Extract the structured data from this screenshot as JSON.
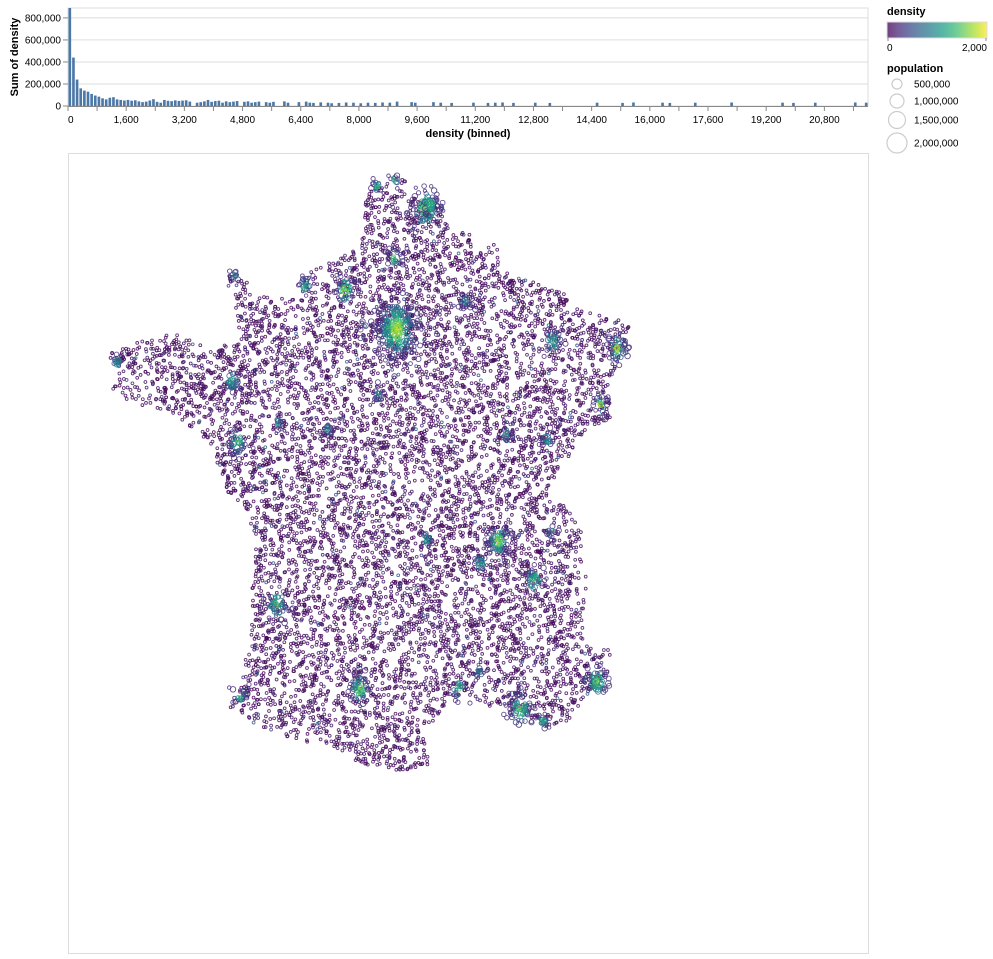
{
  "chart_data": [
    {
      "type": "bar",
      "xlabel": "density (binned)",
      "ylabel": "Sum of density",
      "x_ticks": [
        "0",
        "1,600",
        "3,200",
        "4,800",
        "6,400",
        "8,000",
        "9,600",
        "11,200",
        "12,800",
        "14,400",
        "16,000",
        "17,600",
        "19,200",
        "20,800"
      ],
      "y_ticks": [
        "0",
        "200,000",
        "400,000",
        "600,000",
        "800,000"
      ],
      "xlim": [
        0,
        22000
      ],
      "ylim": [
        0,
        890000
      ],
      "bin_width": 100,
      "bar_color": "#4c78a8",
      "grid": true,
      "bins": [
        {
          "x": 0,
          "y": 890000
        },
        {
          "x": 100,
          "y": 440000
        },
        {
          "x": 200,
          "y": 240000
        },
        {
          "x": 300,
          "y": 160000
        },
        {
          "x": 400,
          "y": 140000
        },
        {
          "x": 500,
          "y": 130000
        },
        {
          "x": 600,
          "y": 110000
        },
        {
          "x": 700,
          "y": 95000
        },
        {
          "x": 800,
          "y": 85000
        },
        {
          "x": 900,
          "y": 70000
        },
        {
          "x": 1000,
          "y": 60000
        },
        {
          "x": 1100,
          "y": 75000
        },
        {
          "x": 1200,
          "y": 80000
        },
        {
          "x": 1300,
          "y": 60000
        },
        {
          "x": 1400,
          "y": 55000
        },
        {
          "x": 1500,
          "y": 50000
        },
        {
          "x": 1600,
          "y": 55000
        },
        {
          "x": 1700,
          "y": 48000
        },
        {
          "x": 1800,
          "y": 52000
        },
        {
          "x": 1900,
          "y": 42000
        },
        {
          "x": 2000,
          "y": 35000
        },
        {
          "x": 2100,
          "y": 40000
        },
        {
          "x": 2200,
          "y": 50000
        },
        {
          "x": 2300,
          "y": 62000
        },
        {
          "x": 2400,
          "y": 38000
        },
        {
          "x": 2500,
          "y": 30000
        },
        {
          "x": 2600,
          "y": 55000
        },
        {
          "x": 2700,
          "y": 47000
        },
        {
          "x": 2800,
          "y": 44000
        },
        {
          "x": 2900,
          "y": 51000
        },
        {
          "x": 3000,
          "y": 46000
        },
        {
          "x": 3100,
          "y": 49000
        },
        {
          "x": 3200,
          "y": 52000
        },
        {
          "x": 3300,
          "y": 40000
        },
        {
          "x": 3500,
          "y": 30000
        },
        {
          "x": 3600,
          "y": 35000
        },
        {
          "x": 3700,
          "y": 42000
        },
        {
          "x": 3800,
          "y": 55000
        },
        {
          "x": 3900,
          "y": 38000
        },
        {
          "x": 4000,
          "y": 45000
        },
        {
          "x": 4100,
          "y": 48000
        },
        {
          "x": 4200,
          "y": 30000
        },
        {
          "x": 4300,
          "y": 42000
        },
        {
          "x": 4400,
          "y": 35000
        },
        {
          "x": 4500,
          "y": 40000
        },
        {
          "x": 4600,
          "y": 45000
        },
        {
          "x": 4800,
          "y": 38000
        },
        {
          "x": 4900,
          "y": 42000
        },
        {
          "x": 5000,
          "y": 30000
        },
        {
          "x": 5100,
          "y": 35000
        },
        {
          "x": 5200,
          "y": 40000
        },
        {
          "x": 5400,
          "y": 35000
        },
        {
          "x": 5500,
          "y": 30000
        },
        {
          "x": 5600,
          "y": 38000
        },
        {
          "x": 5900,
          "y": 42000
        },
        {
          "x": 6000,
          "y": 30000
        },
        {
          "x": 6300,
          "y": 35000
        },
        {
          "x": 6500,
          "y": 40000
        },
        {
          "x": 6600,
          "y": 30000
        },
        {
          "x": 6700,
          "y": 28000
        },
        {
          "x": 6900,
          "y": 33000
        },
        {
          "x": 7100,
          "y": 30000
        },
        {
          "x": 7200,
          "y": 25000
        },
        {
          "x": 7400,
          "y": 28000
        },
        {
          "x": 7600,
          "y": 32000
        },
        {
          "x": 7800,
          "y": 30000
        },
        {
          "x": 8000,
          "y": 25000
        },
        {
          "x": 8200,
          "y": 30000
        },
        {
          "x": 8400,
          "y": 28000
        },
        {
          "x": 8600,
          "y": 32000
        },
        {
          "x": 8800,
          "y": 30000
        },
        {
          "x": 9000,
          "y": 40000
        },
        {
          "x": 9400,
          "y": 35000
        },
        {
          "x": 9500,
          "y": 30000
        },
        {
          "x": 10000,
          "y": 35000
        },
        {
          "x": 10200,
          "y": 30000
        },
        {
          "x": 10500,
          "y": 28000
        },
        {
          "x": 11100,
          "y": 30000
        },
        {
          "x": 11500,
          "y": 28000
        },
        {
          "x": 11700,
          "y": 30000
        },
        {
          "x": 11900,
          "y": 32000
        },
        {
          "x": 12200,
          "y": 28000
        },
        {
          "x": 12800,
          "y": 30000
        },
        {
          "x": 13200,
          "y": 28000
        },
        {
          "x": 14500,
          "y": 30000
        },
        {
          "x": 15200,
          "y": 28000
        },
        {
          "x": 15500,
          "y": 32000
        },
        {
          "x": 16300,
          "y": 30000
        },
        {
          "x": 16500,
          "y": 28000
        },
        {
          "x": 17200,
          "y": 30000
        },
        {
          "x": 18200,
          "y": 32000
        },
        {
          "x": 19600,
          "y": 30000
        },
        {
          "x": 19900,
          "y": 28000
        },
        {
          "x": 20500,
          "y": 30000
        },
        {
          "x": 21600,
          "y": 32000
        },
        {
          "x": 21900,
          "y": 30000
        }
      ]
    },
    {
      "type": "scatter",
      "description_mark": "circle per commune, sized by population, colored by density",
      "color_scale": "viridis",
      "color_domain": [
        0,
        2000
      ],
      "border": true,
      "clusters": [
        {
          "lon": 2.35,
          "lat": 48.86,
          "density": 2000,
          "n": 60,
          "spread": 0.22
        },
        {
          "lon": 3.06,
          "lat": 50.63,
          "density": 1800,
          "n": 22,
          "spread": 0.15
        },
        {
          "lon": 4.84,
          "lat": 45.76,
          "density": 1900,
          "n": 20,
          "spread": 0.12
        },
        {
          "lon": 5.37,
          "lat": 43.3,
          "density": 1800,
          "n": 16,
          "spread": 0.12
        },
        {
          "lon": 1.44,
          "lat": 43.6,
          "density": 1900,
          "n": 14,
          "spread": 0.1
        },
        {
          "lon": -0.58,
          "lat": 44.84,
          "density": 1600,
          "n": 12,
          "spread": 0.12
        },
        {
          "lon": 7.26,
          "lat": 43.7,
          "density": 1900,
          "n": 14,
          "spread": 0.1
        },
        {
          "lon": 7.75,
          "lat": 48.58,
          "density": 1900,
          "n": 12,
          "spread": 0.1
        },
        {
          "lon": -1.55,
          "lat": 47.22,
          "density": 1600,
          "n": 10,
          "spread": 0.1
        },
        {
          "lon": 1.09,
          "lat": 49.44,
          "density": 1900,
          "n": 10,
          "spread": 0.1
        },
        {
          "lon": -1.68,
          "lat": 48.11,
          "density": 1500,
          "n": 8,
          "spread": 0.08
        },
        {
          "lon": 2.3,
          "lat": 49.9,
          "density": 1700,
          "n": 6,
          "spread": 0.08
        },
        {
          "lon": 5.72,
          "lat": 45.19,
          "density": 1700,
          "n": 10,
          "spread": 0.1
        },
        {
          "lon": 6.18,
          "lat": 48.69,
          "density": 1400,
          "n": 8,
          "spread": 0.1
        },
        {
          "lon": 7.34,
          "lat": 47.75,
          "density": 1800,
          "n": 6,
          "spread": 0.08
        },
        {
          "lon": 3.87,
          "lat": 43.61,
          "density": 1600,
          "n": 6,
          "spread": 0.08
        },
        {
          "lon": -1.47,
          "lat": 43.49,
          "density": 1400,
          "n": 6,
          "spread": 0.08
        },
        {
          "lon": 0.1,
          "lat": 49.49,
          "density": 1700,
          "n": 6,
          "spread": 0.06
        },
        {
          "lon": 4.03,
          "lat": 49.26,
          "density": 1400,
          "n": 6,
          "spread": 0.06
        },
        {
          "lon": 5.04,
          "lat": 47.32,
          "density": 1300,
          "n": 5,
          "spread": 0.06
        },
        {
          "lon": 3.08,
          "lat": 45.78,
          "density": 1300,
          "n": 5,
          "spread": 0.06
        },
        {
          "lon": 6.02,
          "lat": 47.24,
          "density": 1300,
          "n": 5,
          "spread": 0.06
        },
        {
          "lon": 1.9,
          "lat": 47.9,
          "density": 1200,
          "n": 4,
          "spread": 0.05
        },
        {
          "lon": 0.69,
          "lat": 47.39,
          "density": 1200,
          "n": 4,
          "spread": 0.05
        },
        {
          "lon": -0.55,
          "lat": 47.47,
          "density": 1300,
          "n": 4,
          "spread": 0.05
        },
        {
          "lon": 4.39,
          "lat": 45.44,
          "density": 1500,
          "n": 5,
          "spread": 0.06
        },
        {
          "lon": 5.93,
          "lat": 43.12,
          "density": 1600,
          "n": 5,
          "spread": 0.06
        },
        {
          "lon": -4.49,
          "lat": 48.39,
          "density": 1300,
          "n": 4,
          "spread": 0.05
        },
        {
          "lon": 4.36,
          "lat": 43.84,
          "density": 1100,
          "n": 3,
          "spread": 0.05
        },
        {
          "lon": 3.17,
          "lat": 50.69,
          "density": 1700,
          "n": 8,
          "spread": 0.08
        },
        {
          "lon": 1.87,
          "lat": 50.95,
          "density": 1500,
          "n": 4,
          "spread": 0.05
        },
        {
          "lon": 2.29,
          "lat": 51.03,
          "density": 1500,
          "n": 3,
          "spread": 0.05
        },
        {
          "lon": -1.62,
          "lat": 49.64,
          "density": 1300,
          "n": 3,
          "spread": 0.04
        },
        {
          "lon": 6.13,
          "lat": 45.9,
          "density": 1400,
          "n": 4,
          "spread": 0.05
        }
      ]
    }
  ],
  "legend": {
    "color": {
      "title": "density",
      "min_label": "0",
      "max_label": "2,000",
      "stops": [
        "#440154",
        "#482878",
        "#3e4989",
        "#31688e",
        "#26828e",
        "#1f9e89",
        "#35b779",
        "#6ece58",
        "#b5de2b",
        "#fde725"
      ]
    },
    "size": {
      "title": "population",
      "entries": [
        {
          "label": "500,000",
          "value": 500000
        },
        {
          "label": "1,000,000",
          "value": 1000000
        },
        {
          "label": "1,500,000",
          "value": 1500000
        },
        {
          "label": "2,000,000",
          "value": 2000000
        }
      ]
    }
  }
}
